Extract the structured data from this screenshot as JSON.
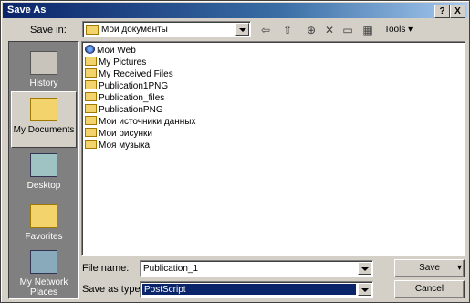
{
  "window": {
    "title": "Save As"
  },
  "titlebar_buttons": {
    "help": "?",
    "close": "X"
  },
  "save_in": {
    "label": "Save in:",
    "value": "Мои документы"
  },
  "toolbar": {
    "tools_label": "Tools ▾"
  },
  "places": [
    {
      "label": "History"
    },
    {
      "label": "My Documents"
    },
    {
      "label": "Desktop"
    },
    {
      "label": "Favorites"
    },
    {
      "label": "My Network Places"
    }
  ],
  "files": [
    {
      "name": "Мои Web",
      "icon": "web-folder-icon"
    },
    {
      "name": "My Pictures",
      "icon": "folder-icon"
    },
    {
      "name": "My Received Files",
      "icon": "folder-icon"
    },
    {
      "name": "Publication1PNG",
      "icon": "folder-icon"
    },
    {
      "name": "Publication_files",
      "icon": "folder-icon"
    },
    {
      "name": "PublicationPNG",
      "icon": "folder-icon"
    },
    {
      "name": "Мои источники данных",
      "icon": "folder-icon"
    },
    {
      "name": "Мои рисунки",
      "icon": "folder-icon"
    },
    {
      "name": "Моя музыка",
      "icon": "folder-icon"
    }
  ],
  "file_name": {
    "label": "File name:",
    "value": "Publication_1"
  },
  "save_as_type": {
    "label": "Save as type:",
    "value": "PostScript"
  },
  "buttons": {
    "save": "Save",
    "cancel": "Cancel"
  }
}
